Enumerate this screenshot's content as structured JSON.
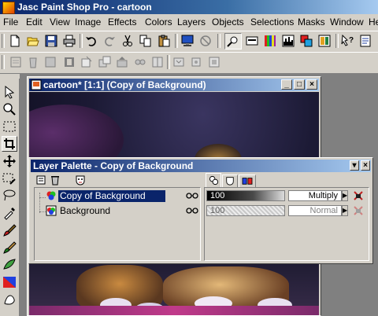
{
  "app": {
    "title": "Jasc Paint Shop Pro - cartoon"
  },
  "menu": [
    "File",
    "Edit",
    "View",
    "Image",
    "Effects",
    "Colors",
    "Layers",
    "Objects",
    "Selections",
    "Masks",
    "Window",
    "He"
  ],
  "image_window": {
    "title": "cartoon* [1:1] (Copy of Background)"
  },
  "layer_palette": {
    "title": "Layer Palette - Copy of Background",
    "layers": [
      {
        "name": "Copy of Background",
        "opacity": "100",
        "blend_mode": "Multiply",
        "selected": true
      },
      {
        "name": "Background",
        "opacity": "100",
        "blend_mode": "Normal",
        "selected": false
      }
    ]
  },
  "colors": {
    "title_active": "#0a246a",
    "title_gradient_end": "#a6caf0",
    "face": "#d4d0c8",
    "selection": "#0a246a"
  }
}
